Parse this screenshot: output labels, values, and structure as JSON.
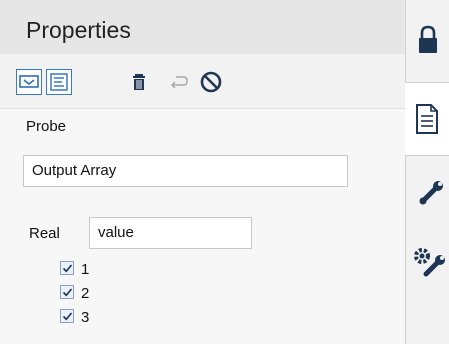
{
  "panel": {
    "title": "Properties",
    "toolbar": {
      "icons": [
        "probe-view-icon",
        "text-view-icon",
        "delete-icon",
        "wrap-icon",
        "disable-icon"
      ]
    },
    "probe_label": "Probe",
    "probe_value": "Output Array",
    "real_label": "Real",
    "real_value": "value",
    "checkboxes": [
      {
        "label": "1",
        "checked": true
      },
      {
        "label": "2",
        "checked": true
      },
      {
        "label": "3",
        "checked": true
      }
    ]
  },
  "side_rail": {
    "tabs": [
      "lock-icon",
      "document-icon",
      "wrench-icon",
      "gear-wrench-icon"
    ],
    "active_tab": "document-icon"
  },
  "colors": {
    "accent_blue": "#3a78c8",
    "icon_dark": "#1f3554",
    "icon_blue": "#2c6fb5",
    "header_bg": "#e6e6e6"
  }
}
